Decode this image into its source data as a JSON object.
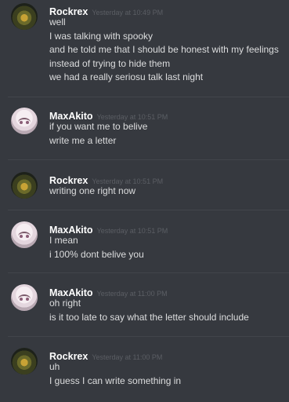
{
  "messages": [
    {
      "username": "Rockrex",
      "timestamp": "Yesterday at 10:49 PM",
      "avatar": "rockrex-avatar-icon",
      "lines": [
        "well",
        "I was talking with spooky",
        "and he told me that I should be honest with my feelings",
        "instead of trying to hide them",
        "we had a really seriosu talk last night"
      ]
    },
    {
      "username": "MaxAkito",
      "timestamp": "Yesterday at 10:51 PM",
      "avatar": "maxakito-avatar-icon",
      "lines": [
        "if you want me to belive",
        "write me a letter"
      ]
    },
    {
      "username": "Rockrex",
      "timestamp": "Yesterday at 10:51 PM",
      "avatar": "rockrex-avatar-icon",
      "lines": [
        "writing one right now"
      ]
    },
    {
      "username": "MaxAkito",
      "timestamp": "Yesterday at 10:51 PM",
      "avatar": "maxakito-avatar-icon",
      "lines": [
        "I mean",
        "i 100% dont belive you"
      ]
    },
    {
      "username": "MaxAkito",
      "timestamp": "Yesterday at 11:00 PM",
      "avatar": "maxakito-avatar-icon",
      "lines": [
        "oh right",
        "is it too late to say what the letter should include"
      ]
    },
    {
      "username": "Rockrex",
      "timestamp": "Yesterday at 11:00 PM",
      "avatar": "rockrex-avatar-icon",
      "lines": [
        "uh",
        "I guess I can write something in"
      ]
    }
  ],
  "colors": {
    "background": "#36393f",
    "username": "#ffffff",
    "timestamp": "#5b5e64",
    "text": "#dcddde",
    "divider": "#42454b"
  }
}
